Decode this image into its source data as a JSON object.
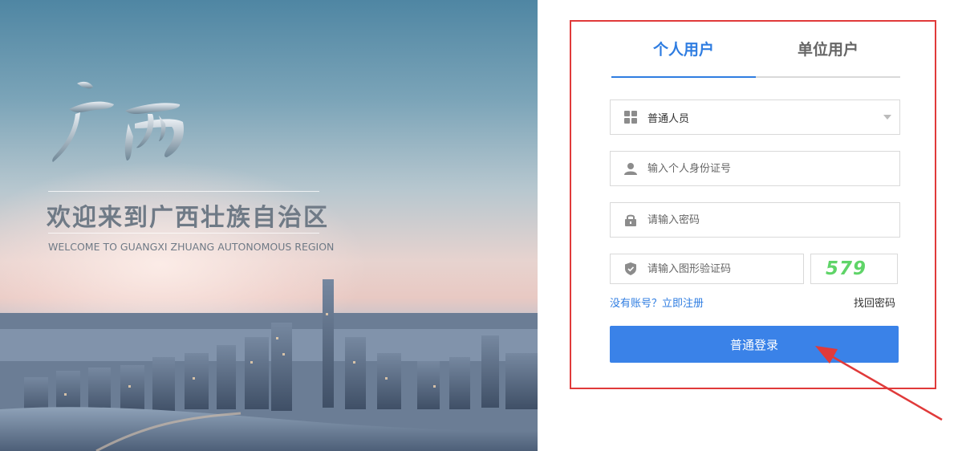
{
  "banner": {
    "calligraphy": "广西",
    "welcome_cn": "欢迎来到广西壮族自治区",
    "welcome_en": "WELCOME TO GUANGXI ZHUANG AUTONOMOUS REGION"
  },
  "login": {
    "tabs": [
      {
        "label": "个人用户",
        "active": true
      },
      {
        "label": "单位用户",
        "active": false
      }
    ],
    "user_type": {
      "selected": "普通人员"
    },
    "id_field": {
      "placeholder": "输入个人身份证号"
    },
    "password_field": {
      "placeholder": "请输入密码"
    },
    "captcha_field": {
      "placeholder": "请输入图形验证码"
    },
    "captcha_image": {
      "text": "579"
    },
    "register_link": "没有账号？立即注册",
    "forgot_link": "找回密码",
    "login_button": "普通登录"
  },
  "colors": {
    "accent": "#2f7de1",
    "button": "#3a82e8",
    "highlight_border": "#e03a3a",
    "captcha": "#5fd468"
  }
}
